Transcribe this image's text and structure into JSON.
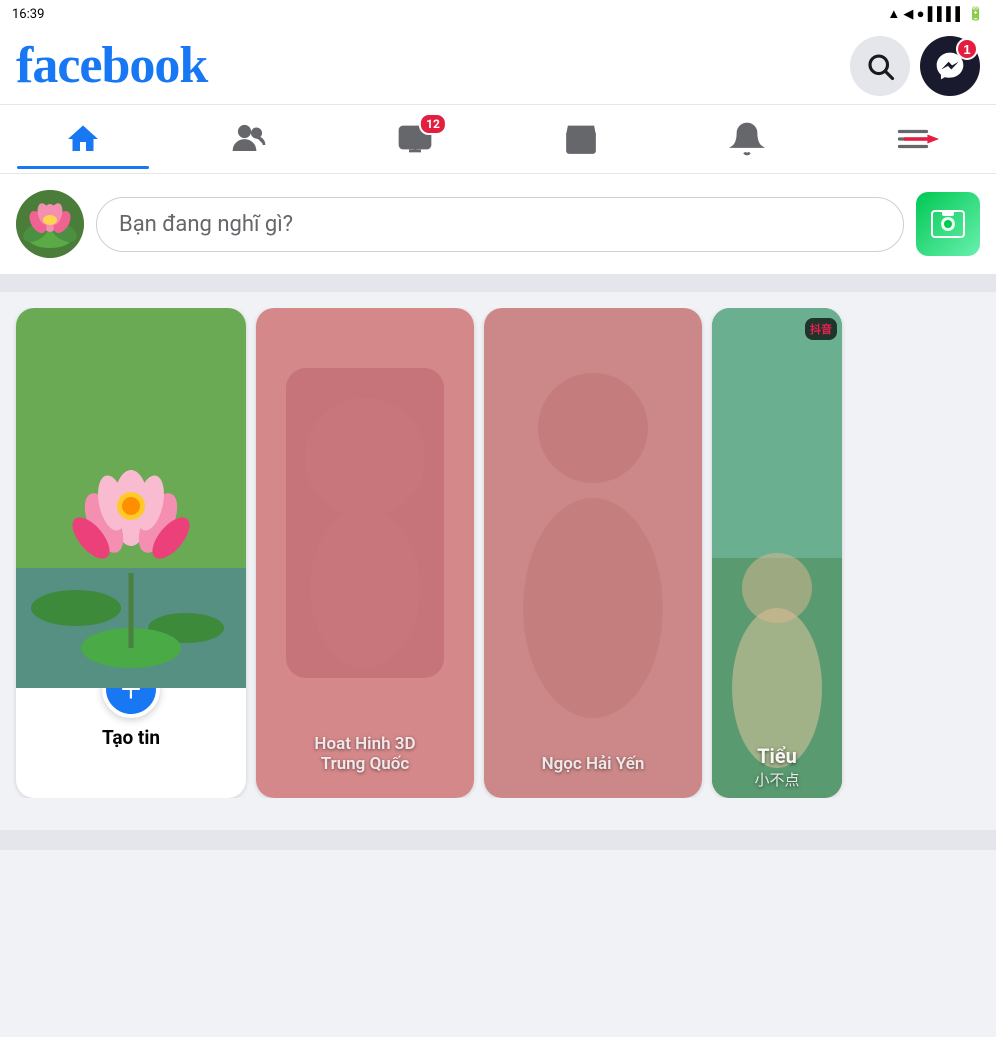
{
  "header": {
    "logo": "facebook",
    "search_label": "Search",
    "messenger_label": "Messenger",
    "messenger_badge": "1"
  },
  "nav": {
    "tabs": [
      {
        "id": "home",
        "label": "Home",
        "active": true,
        "badge": null
      },
      {
        "id": "friends",
        "label": "Friends",
        "active": false,
        "badge": null
      },
      {
        "id": "watch",
        "label": "Watch",
        "active": false,
        "badge": "12"
      },
      {
        "id": "marketplace",
        "label": "Marketplace",
        "active": false,
        "badge": null
      },
      {
        "id": "notifications",
        "label": "Notifications",
        "active": false,
        "badge": null
      },
      {
        "id": "menu",
        "label": "Menu",
        "active": false,
        "badge": null
      }
    ]
  },
  "composer": {
    "placeholder": "Bạn đang nghĩ gì?",
    "photo_label": "Photo"
  },
  "stories": {
    "create_label": "Tạo tin",
    "add_icon": "+",
    "cards": [
      {
        "id": "story1",
        "type": "user",
        "name": "Hoat Hinh 3D\nTrung Quoc",
        "color_top": "#d4808080",
        "color_bottom": "#e89090"
      },
      {
        "id": "story2",
        "type": "user",
        "name": "Ngọc Hải Yến",
        "color_top": "#d4808080",
        "color_bottom": "#e89090"
      },
      {
        "id": "story3",
        "type": "tiktok",
        "name": "Tiểu",
        "name_zh": "小不点",
        "color_top": "#4a8a70"
      }
    ]
  },
  "arrow": {
    "label": "Arrow pointing to menu"
  }
}
